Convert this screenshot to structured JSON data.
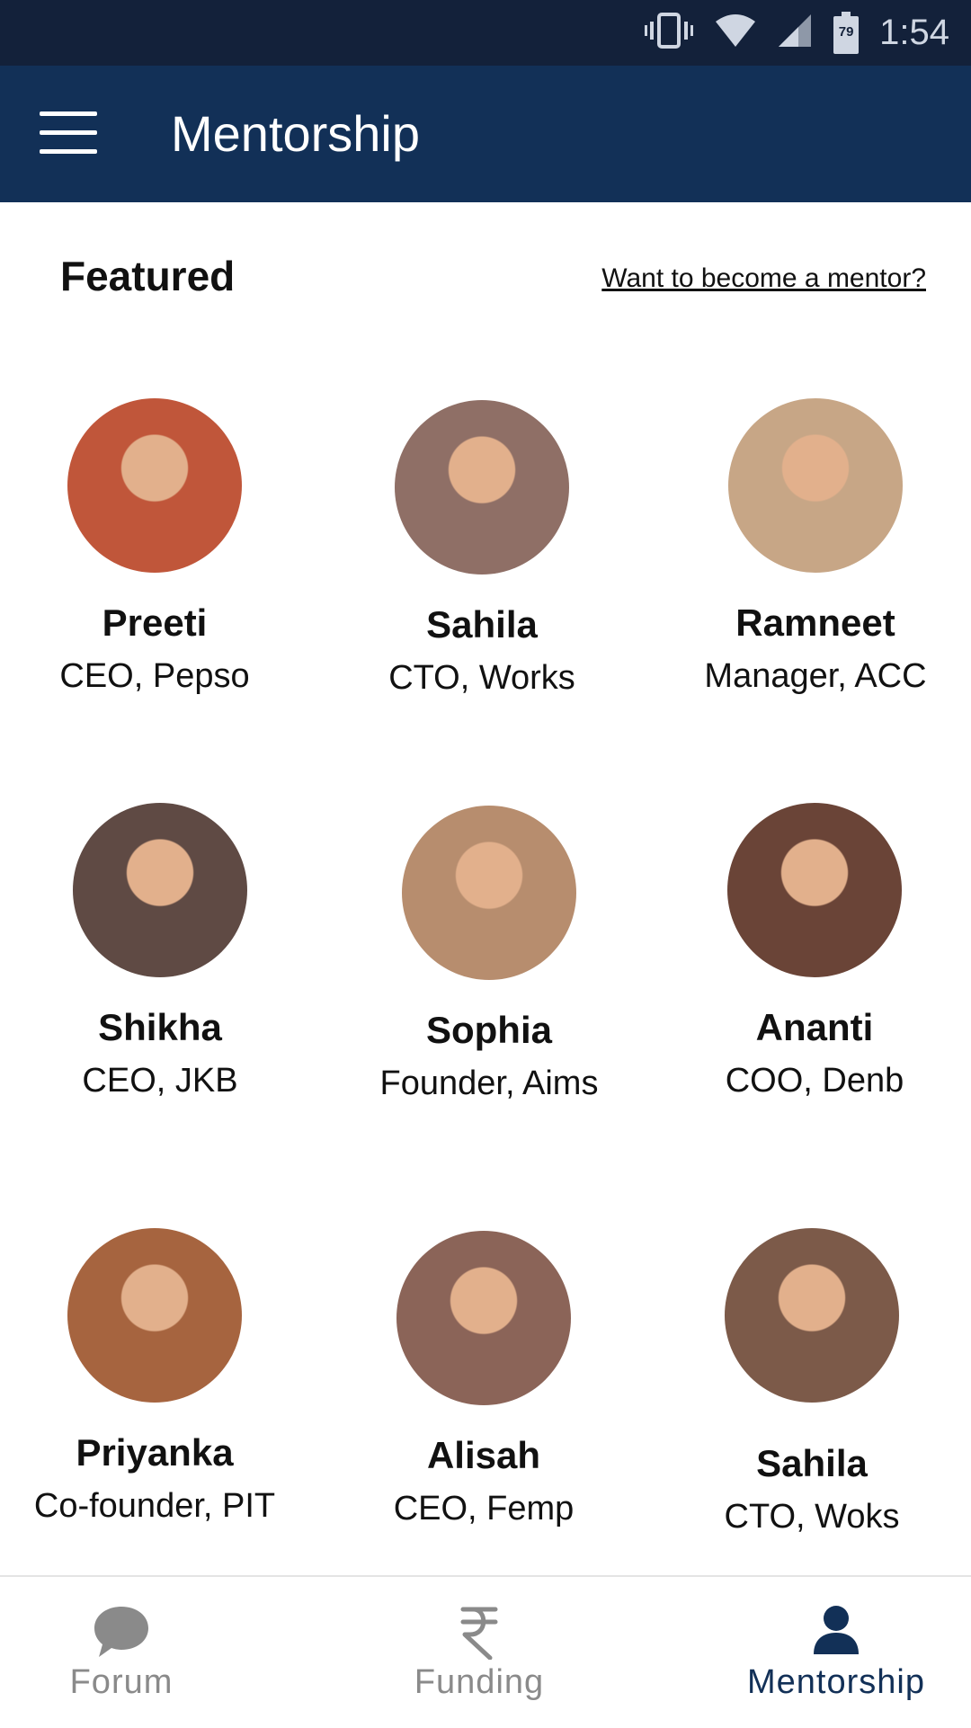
{
  "status_bar": {
    "time": "1:54",
    "battery": "79",
    "icons": [
      "vibrate-icon",
      "wifi-icon",
      "signal-icon",
      "battery-icon"
    ]
  },
  "app_bar": {
    "menu_icon": "hamburger-menu-icon",
    "title": "Mentorship"
  },
  "featured": {
    "heading": "Featured",
    "become_mentor_link": "Want to become a mentor?"
  },
  "mentors": [
    {
      "name": "Preeti",
      "role": "CEO, Pepso",
      "avatar_color": "#c0563a"
    },
    {
      "name": "Sahila",
      "role": "CTO, Works",
      "avatar_color": "#8f6f66"
    },
    {
      "name": "Ramneet",
      "role": "Manager, ACC",
      "avatar_color": "#c7a686"
    },
    {
      "name": "Shikha",
      "role": "CEO, JKB",
      "avatar_color": "#5f4a44"
    },
    {
      "name": "Sophia",
      "role": "Founder, Aims",
      "avatar_color": "#b78d6e"
    },
    {
      "name": "Ananti",
      "role": "COO, Denb",
      "avatar_color": "#6a4437"
    },
    {
      "name": "Priyanka",
      "role": "Co-founder, PIT",
      "avatar_color": "#a6643f"
    },
    {
      "name": "Alisah",
      "role": "CEO, Femp",
      "avatar_color": "#8b6458"
    },
    {
      "name": "Sahila",
      "role": "CTO, Woks",
      "avatar_color": "#7c5a49"
    }
  ],
  "bottom_nav": {
    "items": [
      {
        "label": "Forum",
        "icon": "chat-bubble-icon",
        "active": false
      },
      {
        "label": "Funding",
        "icon": "rupee-icon",
        "active": false
      },
      {
        "label": "Mentorship",
        "icon": "person-icon",
        "active": true
      }
    ]
  },
  "colors": {
    "status_bar": "#13213a",
    "app_bar": "#123057",
    "active_nav": "#123057",
    "inactive_nav": "#8a8a8a"
  }
}
